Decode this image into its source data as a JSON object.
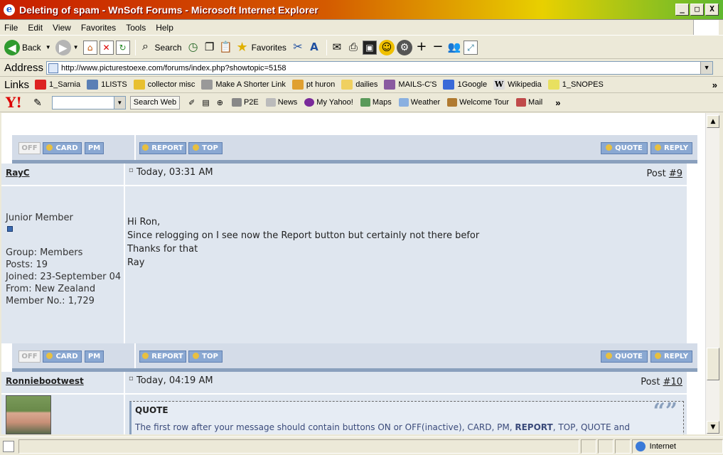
{
  "window": {
    "title": "Deleting of spam - WnSoft Forums - Microsoft Internet Explorer",
    "min": "_",
    "max": "□",
    "close": "X"
  },
  "menu": [
    "File",
    "Edit",
    "View",
    "Favorites",
    "Tools",
    "Help"
  ],
  "toolbar": {
    "back": "Back",
    "search": "Search",
    "favorites": "Favorites"
  },
  "address": {
    "label": "Address",
    "url": "http://www.picturestoexe.com/forums/index.php?showtopic=5158"
  },
  "links": {
    "header": "Links",
    "items": [
      "1_Sarnia",
      "1LISTS",
      "collector misc",
      "Make A Shorter Link",
      "pt huron",
      "dailies",
      "MAILS-C'S",
      "1Google",
      "Wikipedia",
      "1_SNOPES"
    ],
    "more": "»"
  },
  "yahoo": {
    "logo": "Y!",
    "search_btn": "Search Web",
    "items": [
      "P2E",
      "News",
      "My Yahoo!",
      "Maps",
      "Weather",
      "Welcome Tour",
      "Mail"
    ],
    "more": "»"
  },
  "buttons": {
    "off": "OFF",
    "card": "CARD",
    "pm": "PM",
    "report": "REPORT",
    "top": "TOP",
    "quote": "QUOTE",
    "reply": "REPLY"
  },
  "post1": {
    "author": "RayC",
    "time": "Today, 03:31 AM",
    "post_label": "Post ",
    "post_no": "#9",
    "rank": "Junior Member",
    "group": "Group: Members",
    "posts": "Posts: 19",
    "joined": "Joined: 23-September 04",
    "from": "From: New Zealand",
    "member_no": "Member No.: 1,729",
    "lines": [
      "Hi Ron,",
      "Since relogging on I see now the Report button but certainly not there befor",
      "Thanks for that",
      "Ray"
    ]
  },
  "post2": {
    "author": "Ronniebootwest",
    "time": "Today, 04:19 AM",
    "post_label": "Post ",
    "post_no": "#10",
    "quote_title": "QUOTE",
    "quote_pre": "The first row after your message should contain buttons ON or OFF(inactive), CARD, PM, ",
    "quote_bold": "REPORT",
    "quote_post": ", TOP, QUOTE and"
  },
  "status": {
    "zone": "Internet"
  }
}
